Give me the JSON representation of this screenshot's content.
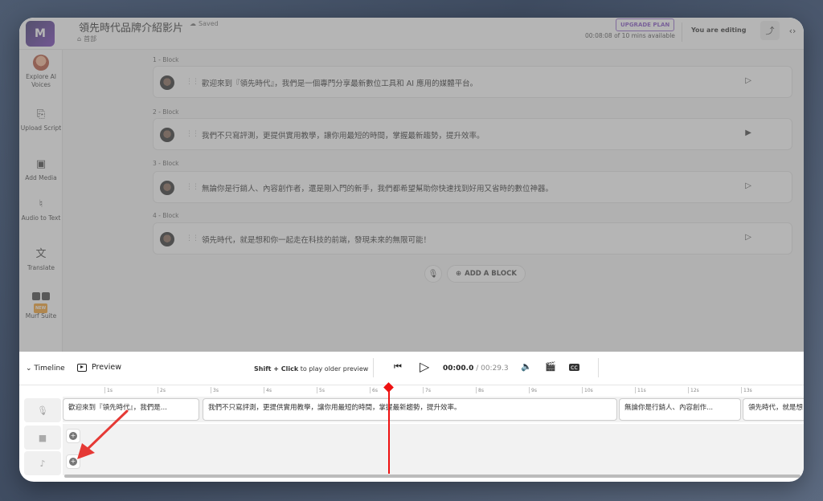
{
  "header": {
    "logo": "M",
    "project_title": "領先時代品牌介紹影片",
    "saved": "Saved",
    "breadcrumb": "首部",
    "upgrade": "UPGRADE PLAN",
    "time_left": "00:08:08 of 10 mins available",
    "editing": "You are editing"
  },
  "sidebar": {
    "items": [
      {
        "label": "Explore AI Voices"
      },
      {
        "label": "Upload Script"
      },
      {
        "label": "Add Media"
      },
      {
        "label": "Audio to Text"
      },
      {
        "label": "Translate"
      },
      {
        "label": "Murf Suite",
        "badge": "NEW"
      }
    ]
  },
  "blocks": [
    {
      "label": "1 -  Block",
      "text": "歡迎來到『領先時代』，我們是一個專門分享最新數位工具和 AI 應用的媒體平台。"
    },
    {
      "label": "2 -  Block",
      "text": "我們不只寫評測，更提供實用教學，讓你用最短的時間，掌握最新趨勢，提升效率。"
    },
    {
      "label": "3 -  Block",
      "text": "無論你是行銷人、內容創作者，還是剛入門的新手，我們都希望幫助你快速找到好用又省時的數位神器。"
    },
    {
      "label": "4 -  Block",
      "text": "領先時代，就是想和你一起走在科技的前端，發現未來的無限可能！"
    }
  ],
  "add_block": "ADD A BLOCK",
  "timeline": {
    "label": "Timeline",
    "preview": "Preview",
    "hint_bold": "Shift + Click",
    "hint_rest": " to play older preview",
    "time_current": "00:00.0",
    "time_total": " / 00:29.3",
    "ticks": [
      "1s",
      "2s",
      "3s",
      "4s",
      "5s",
      "6s",
      "7s",
      "8s",
      "9s",
      "10s",
      "11s",
      "12s",
      "13s"
    ],
    "clips": [
      {
        "text": "歡迎來到『領先時代』，我們是..."
      },
      {
        "text": "我們不只寫評測，更提供實用教學，讓你用最短的時間，掌握最新趨勢，提升效率。"
      },
      {
        "text": "無論你是行銷人、內容創作..."
      },
      {
        "text": "領先時代，就是想"
      }
    ]
  },
  "colors": {
    "accent": "#7a45c0",
    "playhead": "#e11111",
    "arrow": "#e53935"
  }
}
